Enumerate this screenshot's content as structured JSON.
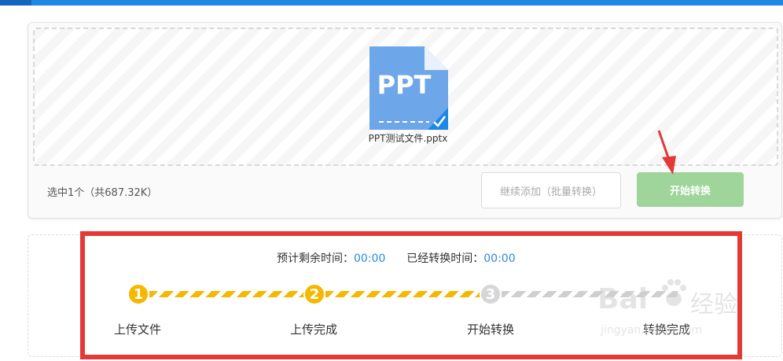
{
  "file": {
    "icon_text": "PPT",
    "name": "PPT测试文件.pptx"
  },
  "footer": {
    "count_text": "选中1个（共687.32K）",
    "continue_label": "继续添加（批量转换）",
    "start_label": "开始转换"
  },
  "progress": {
    "remaining_label": "预计剩余时间：",
    "remaining_value": "00:00",
    "elapsed_label": "已经转换时间：",
    "elapsed_value": "00:00",
    "steps": [
      {
        "num": "1",
        "label": "上传文件",
        "status": "done"
      },
      {
        "num": "2",
        "label": "上传完成",
        "status": "done"
      },
      {
        "num": "3",
        "label": "开始转换",
        "status": "pending"
      },
      {
        "num": "",
        "label": "转换完成",
        "status": "pending"
      }
    ]
  },
  "watermark": {
    "brand": "Bai",
    "suffix": "经验",
    "url": "jingyan.baidu.com"
  },
  "colors": {
    "accent": "#1e88e5",
    "step_done": "#f5b800",
    "start_button": "#9fd49a",
    "time_value": "#2b8ae2",
    "highlight_box": "#e53935"
  }
}
